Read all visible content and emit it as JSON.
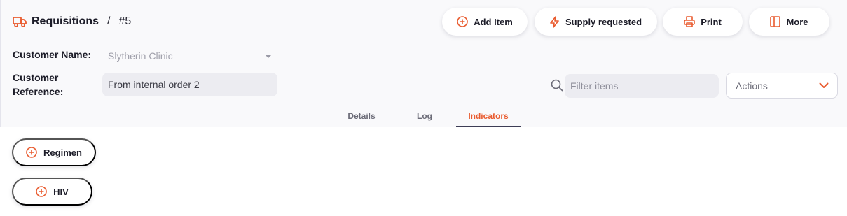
{
  "header": {
    "title": "Requisitions",
    "separator": "/",
    "number": "#5",
    "title_icon": "truck-icon"
  },
  "toolbar": {
    "add_item": "Add Item",
    "supply_requested": "Supply requested",
    "print": "Print",
    "more": "More"
  },
  "form": {
    "customer_name_label": "Customer Name:",
    "customer_name_value": "Slytherin Clinic",
    "customer_reference_label_1": "Customer",
    "customer_reference_label_2": "Reference:",
    "customer_reference_value": "From internal order 2"
  },
  "filter": {
    "placeholder": "Filter items"
  },
  "actions": {
    "label": "Actions"
  },
  "tabs": [
    {
      "label": "Details",
      "active": false
    },
    {
      "label": "Log",
      "active": false
    },
    {
      "label": "Indicators",
      "active": true
    }
  ],
  "indicators": [
    {
      "label": "Regimen"
    },
    {
      "label": "HIV"
    }
  ],
  "colors": {
    "accent": "#e95c30",
    "header_bg": "#f9f9fb",
    "field_bg": "#ececf1",
    "tab_underline": "#3d3d56"
  }
}
